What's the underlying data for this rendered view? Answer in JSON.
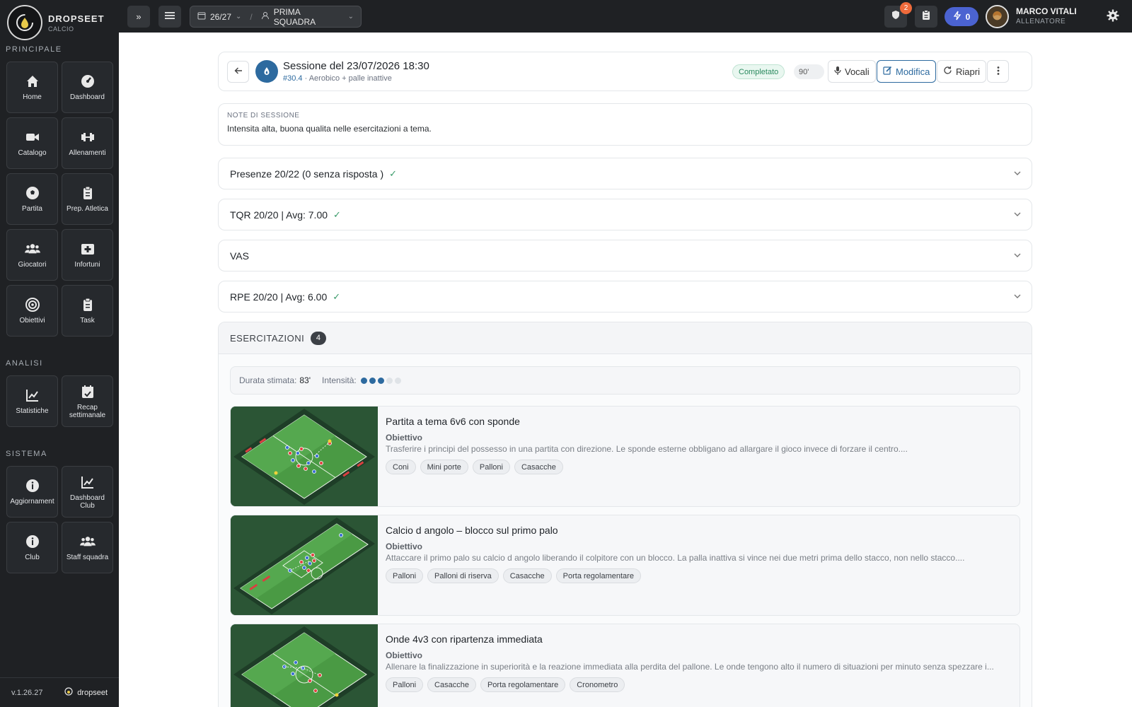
{
  "brand": {
    "name": "DROPSEET",
    "sub": "CALCIO"
  },
  "sidebar": {
    "section_main": "PRINCIPALE",
    "section_analysis": "ANALISI",
    "section_system": "SISTEMA",
    "items": [
      {
        "label": "Home",
        "icon": "home-icon"
      },
      {
        "label": "Dashboard",
        "icon": "gauge-icon"
      },
      {
        "label": "Catalogo",
        "icon": "video-icon"
      },
      {
        "label": "Allenamenti",
        "icon": "dumbbell-icon"
      },
      {
        "label": "Partita",
        "icon": "soccer-ball-icon"
      },
      {
        "label": "Prep. Atletica",
        "icon": "clipboard-icon"
      },
      {
        "label": "Giocatori",
        "icon": "users-icon"
      },
      {
        "label": "Infortuni",
        "icon": "medkit-icon"
      },
      {
        "label": "Obiettivi",
        "icon": "target-icon"
      },
      {
        "label": "Task",
        "icon": "task-clipboard-icon"
      }
    ],
    "analysis_items": [
      {
        "label": "Statistiche",
        "icon": "line-chart-icon"
      },
      {
        "label": "Recap settimanale",
        "icon": "calendar-check-icon"
      }
    ],
    "system_items": [
      {
        "label": "Aggiornament",
        "icon": "info-icon"
      },
      {
        "label": "Dashboard Club",
        "icon": "line-chart-icon"
      },
      {
        "label": "Club",
        "icon": "info-icon"
      },
      {
        "label": "Staff squadra",
        "icon": "users-icon"
      }
    ],
    "version": "v.1.26.27",
    "footer_brand": "dropseet"
  },
  "topbar": {
    "expand_label": "»",
    "season": "26/27",
    "team": "PRIMA SQUADRA",
    "notification_count": "2",
    "credits": "0",
    "user_name": "MARCO VITALI",
    "user_role": "ALLENATORE"
  },
  "session": {
    "title": "Sessione del 23/07/2026 18:30",
    "number": "#30.4",
    "subtitle": "· Aerobico + palle inattive",
    "status": "Completato",
    "duration": "90'",
    "btn_voice": "Vocali",
    "btn_edit": "Modifica",
    "btn_reopen": "Riapri"
  },
  "notes": {
    "label": "NOTE DI SESSIONE",
    "text": "Intensita alta, buona qualita nelle esercitazioni a tema."
  },
  "accordions": [
    {
      "label": "Presenze 20/22 (0 senza risposta )",
      "checked": true
    },
    {
      "label": "TQR 20/20 | Avg: 7.00",
      "checked": true
    },
    {
      "label": "VAS",
      "checked": false
    },
    {
      "label": "RPE 20/20 | Avg: 6.00",
      "checked": true
    }
  ],
  "exercises": {
    "heading": "ESERCITAZIONI",
    "count": "4",
    "duration_label": "Durata stimata:",
    "duration_value": "83'",
    "intensity_label": "Intensità:",
    "intensity_level": 3,
    "intensity_max": 5,
    "colors": {
      "active": "#2d6a9f",
      "inactive": "#dfe3e7"
    },
    "items": [
      {
        "title": "Partita a tema 6v6 con sponde",
        "objective_label": "Obiettivo",
        "objective": "Trasferire i principi del possesso in una partita con direzione. Le sponde esterne obbligano ad allargare il gioco invece di forzare il centro....",
        "tags": [
          "Coni",
          "Mini porte",
          "Palloni",
          "Casacche"
        ]
      },
      {
        "title": "Calcio d angolo – blocco sul primo palo",
        "objective_label": "Obiettivo",
        "objective": "Attaccare il primo palo su calcio d angolo liberando il colpitore con un blocco. La palla inattiva si vince nei due metri prima dello stacco, non nello stacco....",
        "tags": [
          "Palloni",
          "Palloni di riserva",
          "Casacche",
          "Porta regolamentare"
        ]
      },
      {
        "title": "Onde 4v3 con ripartenza immediata",
        "objective_label": "Obiettivo",
        "objective": "Allenare la finalizzazione in superiorità e la reazione immediata alla perdita del pallone. Le onde tengono alto il numero di situazioni per minuto senza spezzare i...",
        "tags": [
          "Palloni",
          "Casacche",
          "Porta regolamentare",
          "Cronometro"
        ]
      }
    ]
  }
}
